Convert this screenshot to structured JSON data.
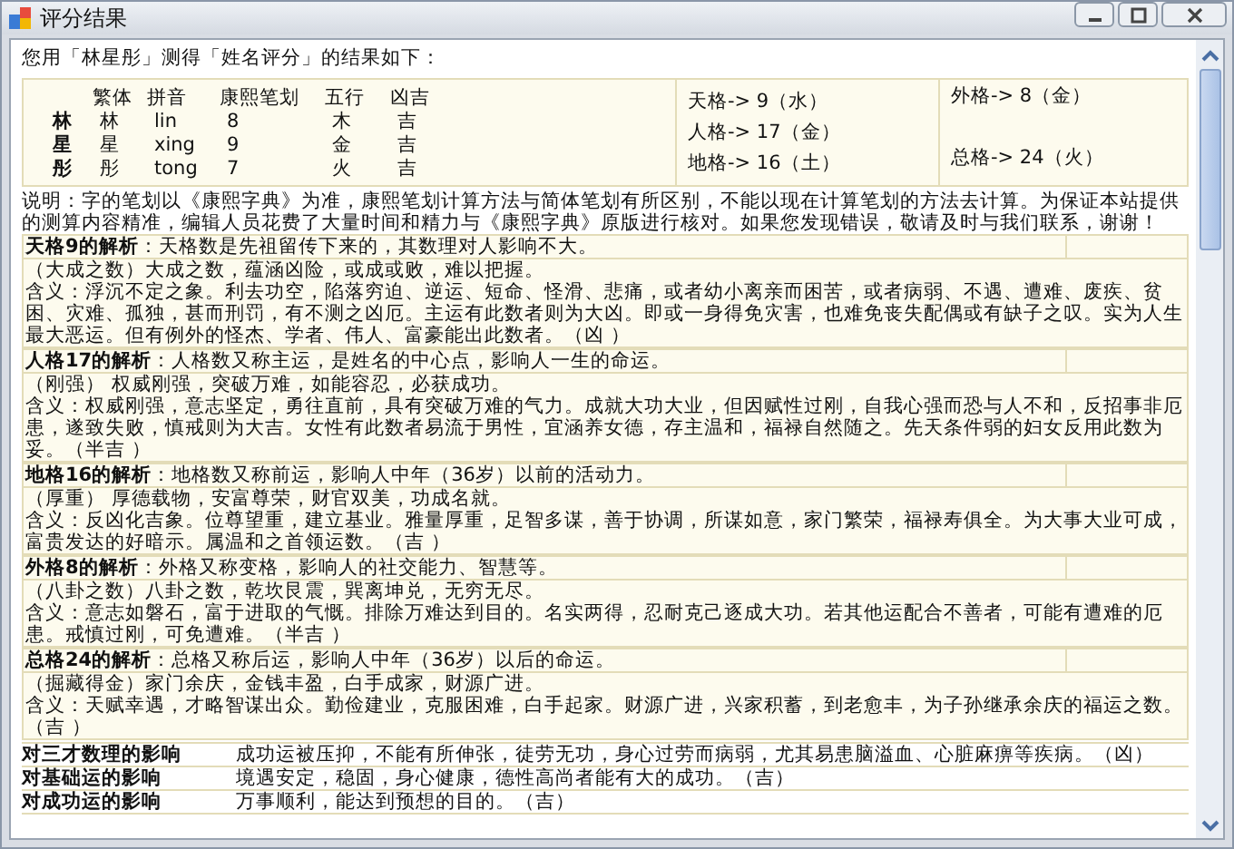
{
  "window": {
    "title": "评分结果"
  },
  "intro": "您用「林星彤」测得「姓名评分」的结果如下：",
  "chars": {
    "columns": [
      "繁体",
      "拼音",
      "康熙笔划",
      "五行",
      "凶吉"
    ],
    "rows": [
      {
        "char": "林",
        "traditional": "林",
        "pinyin": "lin",
        "strokes": "8",
        "element": "木",
        "luck": "吉"
      },
      {
        "char": "星",
        "traditional": "星",
        "pinyin": "xing",
        "strokes": "9",
        "element": "金",
        "luck": "吉"
      },
      {
        "char": "彤",
        "traditional": "彤",
        "pinyin": "tong",
        "strokes": "7",
        "element": "火",
        "luck": "吉"
      }
    ]
  },
  "grids_left": [
    "天格-> 9（水）",
    "人格-> 17（金）",
    "地格-> 16（土）"
  ],
  "grids_right": [
    "外格-> 8（金）",
    "总格-> 24（火）"
  ],
  "note": "说明：字的笔划以《康熙字典》为准，康熙笔划计算方法与简体笔划有所区别，不能以现在计算笔划的方法去计算。为保证本站提供的测算内容精准，编辑人员花费了大量时间和精力与《康熙字典》原版进行核对。如果您发现错误，敬请及时与我们联系，谢谢！",
  "analyses": [
    {
      "heading": "天格9的解析",
      "summary": "：天格数是先祖留传下来的，其数理对人影响不大。",
      "lines": [
        "（大成之数）大成之数，蕴涵凶险，或成或败，难以把握。",
        "含义：浮沉不定之象。利去功空，陷落穷迫、逆运、短命、怪滑、悲痛，或者幼小离亲而困苦，或者病弱、不遇、遭难、废疾、贫困、灾难、孤独，甚而刑罚，有不测之凶厄。主运有此数者则为大凶。即或一身得免灾害，也难免丧失配偶或有缺子之叹。实为人生最大恶运。但有例外的怪杰、学者、伟人、富豪能出此数者。（凶 ）"
      ]
    },
    {
      "heading": "人格17的解析",
      "summary": "：人格数又称主运，是姓名的中心点，影响人一生的命运。",
      "lines": [
        "（刚强） 权威刚强，突破万难，如能容忍，必获成功。",
        "含义：权威刚强，意志坚定，勇往直前，具有突破万难的气力。成就大功大业，但因赋性过刚，自我心强而恐与人不和，反招事非厄患，遂致失败，慎戒则为大吉。女性有此数者易流于男性，宜涵养女德，存主温和，福禄自然随之。先天条件弱的妇女反用此数为妥。（半吉 ）"
      ]
    },
    {
      "heading": "地格16的解析",
      "summary": "：地格数又称前运，影响人中年（36岁）以前的活动力。",
      "lines": [
        "（厚重） 厚德载物，安富尊荣，财官双美，功成名就。",
        "含义：反凶化吉象。位尊望重，建立基业。雅量厚重，足智多谋，善于协调，所谋如意，家门繁荣，福禄寿俱全。为大事大业可成，富贵发达的好暗示。属温和之首领运数。（吉 ）"
      ]
    },
    {
      "heading": "外格8的解析",
      "summary": "：外格又称变格，影响人的社交能力、智慧等。",
      "lines": [
        "（八卦之数）八卦之数，乾坎艮震，巽离坤兑，无穷无尽。",
        "含义：意志如磐石，富于进取的气慨。排除万难达到目的。名实两得，忍耐克己逐成大功。若其他运配合不善者，可能有遭难的厄患。戒慎过刚，可免遭难。（半吉 ）"
      ]
    },
    {
      "heading": "总格24的解析",
      "summary": "：总格又称后运，影响人中年（36岁）以后的命运。",
      "lines": [
        "（掘藏得金）家门余庆，金钱丰盈，白手成家，财源广进。",
        "含义：天赋幸遇，才略智谋出众。勤俭建业，克服困难，白手起家。财源广进，兴家积蓄，到老愈丰，为子孙继承余庆的福运之数。（吉 ）"
      ]
    }
  ],
  "influences": [
    {
      "label": "对三才数理的影响",
      "text": "成功运被压抑，不能有所伸张，徒劳无功，身心过劳而病弱，尤其易患脑溢血、心脏麻痹等疾病。（凶）"
    },
    {
      "label": "对基础运的影响",
      "text": "境遇安定，稳固，身心健康，德性高尚者能有大的成功。（吉）"
    },
    {
      "label": "对成功运的影响",
      "text": "万事顺利，能达到预想的目的。（吉）"
    }
  ]
}
